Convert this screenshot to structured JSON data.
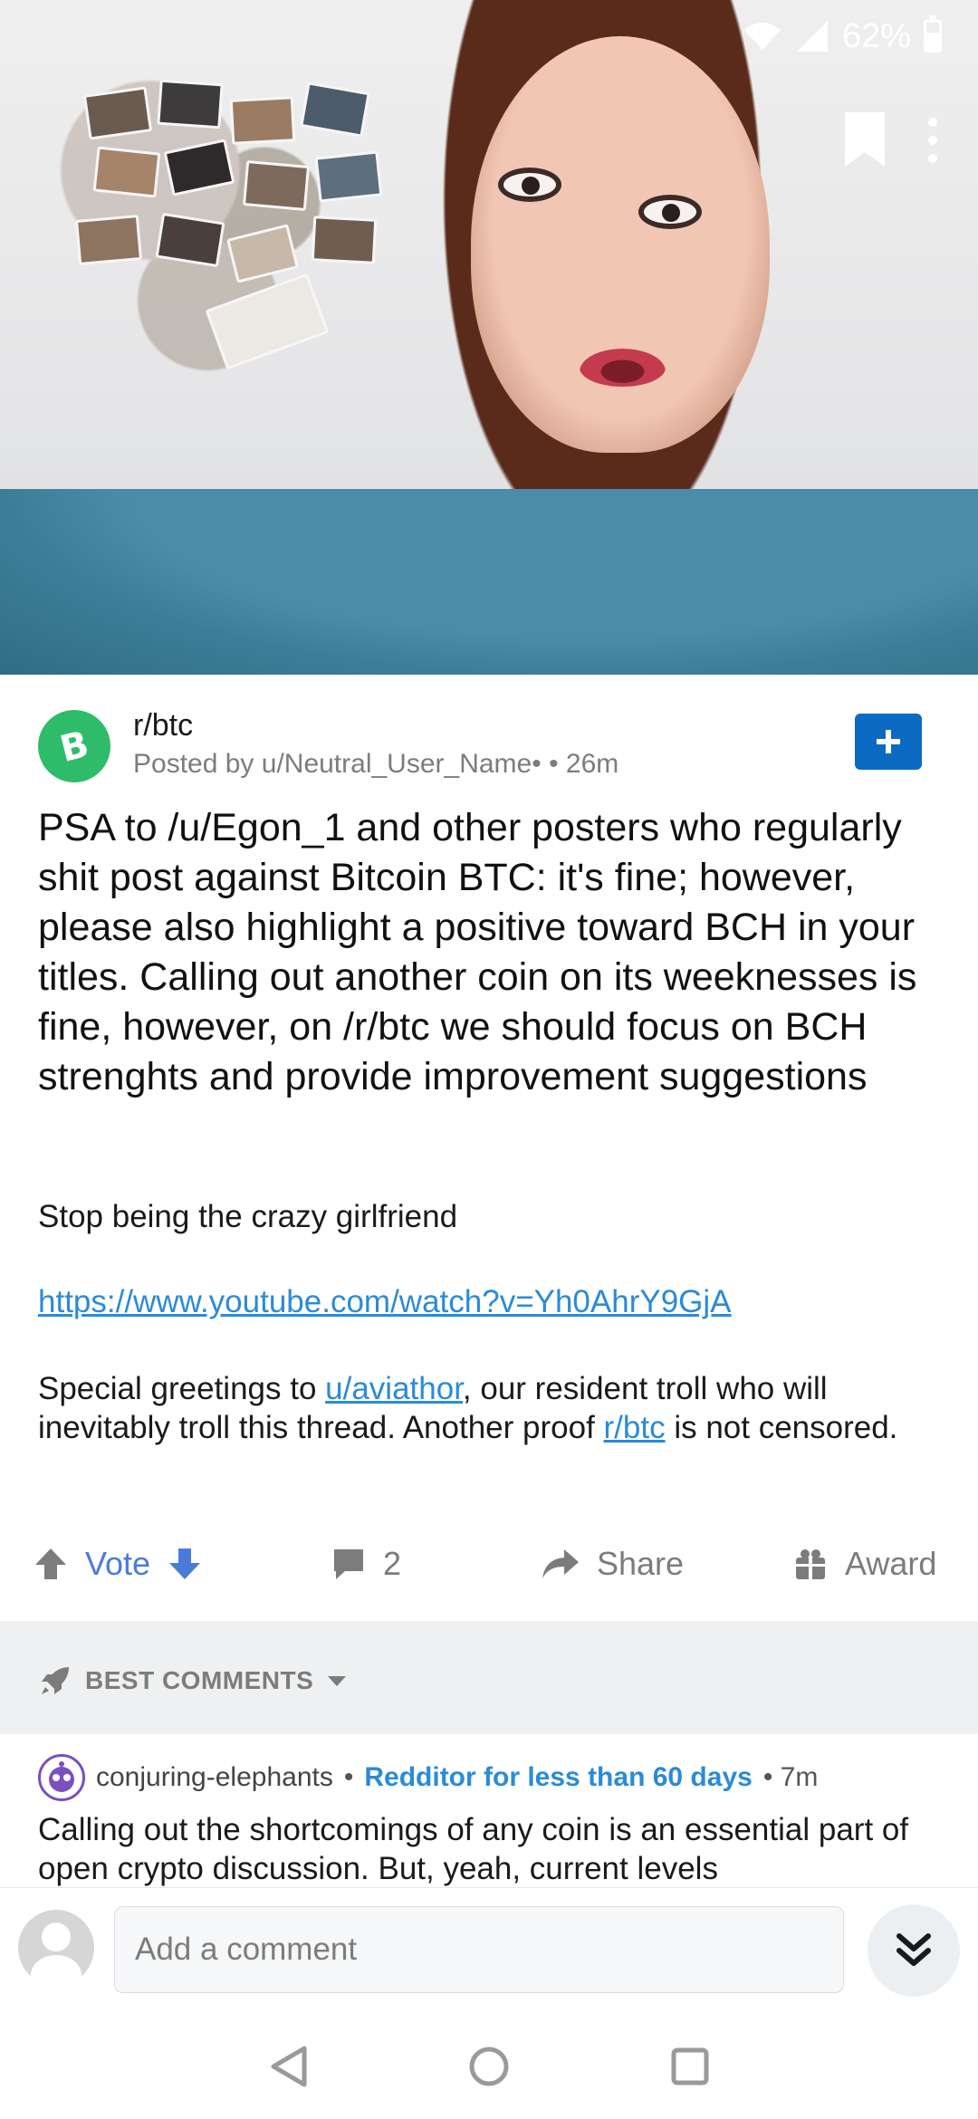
{
  "status_bar": {
    "battery": "62%"
  },
  "post": {
    "subreddit": "r/btc",
    "posted_by": "Posted by u/Neutral_User_Name•",
    "age": "• 26m",
    "title": "PSA to /u/Egon_1 and other posters who regularly shit post against Bitcoin BTC: it's fine; however, please also highlight a positive toward BCH in your titles. Calling out another coin on its weeknesses is fine, however, on /r/btc we should focus on BCH strenghts and provide improvement suggestions",
    "body_line1": "Stop being the crazy girlfriend",
    "link": "https://www.youtube.com/watch?v=Yh0AhrY9GjA",
    "greet_a": "Special greetings to ",
    "greet_user": "u/aviathor",
    "greet_b": ", our resident troll who will inevitably troll this thread. Another proof ",
    "greet_sub": "r/btc",
    "greet_c": " is not censored."
  },
  "actions": {
    "vote_label": "Vote",
    "comment_count": "2",
    "share_label": "Share",
    "award_label": "Award"
  },
  "sort": {
    "label": "BEST COMMENTS"
  },
  "comment": {
    "username": "conjuring-elephants",
    "sep1": "•",
    "flair": "Redditor for less than 60 days",
    "age": "• 7m",
    "text": "Calling out the shortcomings of any coin is an essential part of open crypto discussion.  But, yeah, current levels"
  },
  "composer": {
    "placeholder": "Add a comment"
  },
  "colors": {
    "accent": "#0b6bc2",
    "vote": "#4b7bd9",
    "link": "#2b8bd6",
    "subreddit_icon": "#2fbc6a"
  }
}
